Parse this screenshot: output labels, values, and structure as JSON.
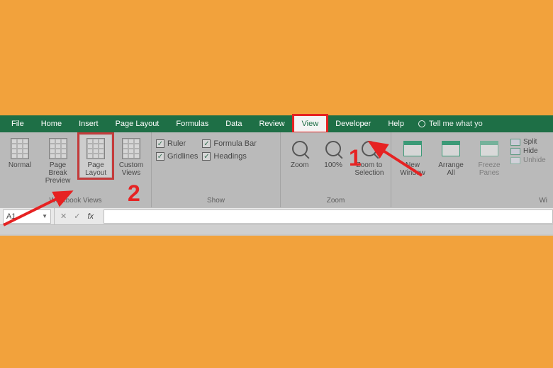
{
  "tabs": {
    "file": "File",
    "home": "Home",
    "insert": "Insert",
    "page_layout": "Page Layout",
    "formulas": "Formulas",
    "data": "Data",
    "review": "Review",
    "view": "View",
    "developer": "Developer",
    "help": "Help",
    "tellme": "Tell me what yo"
  },
  "ribbon": {
    "views": {
      "normal": "Normal",
      "page_break": "Page Break Preview",
      "page_layout": "Page Layout",
      "custom": "Custom Views",
      "group": "Workbook Views"
    },
    "show": {
      "ruler": "Ruler",
      "gridlines": "Gridlines",
      "formula_bar": "Formula Bar",
      "headings": "Headings",
      "group": "Show"
    },
    "zoom": {
      "zoom": "Zoom",
      "hundred": "100%",
      "selection": "Zoom to Selection",
      "group": "Zoom"
    },
    "window": {
      "new": "New Window",
      "arrange": "Arrange All",
      "freeze": "Freeze Panes",
      "split": "Split",
      "hide": "Hide",
      "unhide": "Unhide",
      "group": "Wi"
    }
  },
  "formula_bar": {
    "cell": "A1",
    "fx": "fx"
  },
  "annotations": {
    "one": "1",
    "two": "2"
  },
  "checkmark": "✓"
}
